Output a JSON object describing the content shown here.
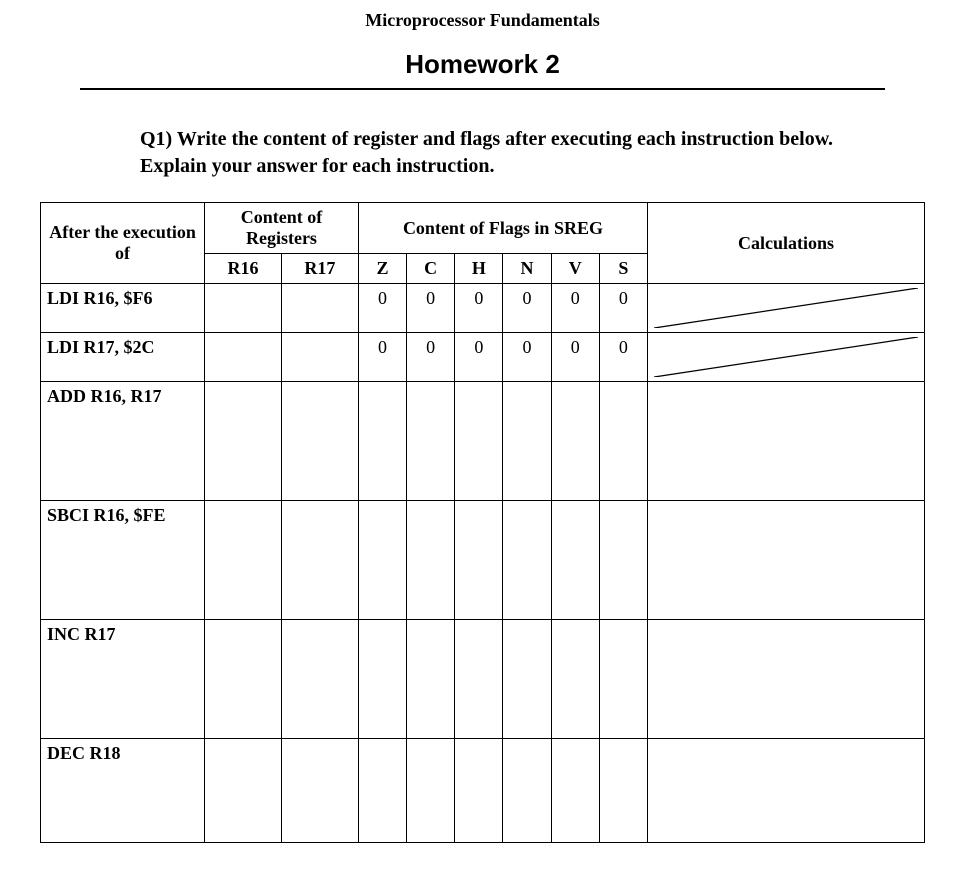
{
  "header": {
    "course": "Microprocessor Fundamentals",
    "title": "Homework 2"
  },
  "question": "Q1) Write the content of register and flags after executing each instruction below. Explain your answer for each instruction.",
  "table": {
    "headers": {
      "exec": "After the execution of",
      "regs": "Content of Registers",
      "flags": "Content of Flags in SREG",
      "calc": "Calculations",
      "r16": "R16",
      "r17": "R17",
      "z": "Z",
      "c": "C",
      "h": "H",
      "n": "N",
      "v": "V",
      "s": "S"
    },
    "rows": [
      {
        "instr": "LDI R16, $F6",
        "r16": "",
        "r17": "",
        "z": "0",
        "c": "0",
        "h": "0",
        "n": "0",
        "v": "0",
        "s": "0",
        "calc": "slash"
      },
      {
        "instr": "LDI R17, $2C",
        "r16": "",
        "r17": "",
        "z": "0",
        "c": "0",
        "h": "0",
        "n": "0",
        "v": "0",
        "s": "0",
        "calc": "slash"
      },
      {
        "instr": "ADD R16, R17",
        "r16": "",
        "r17": "",
        "z": "",
        "c": "",
        "h": "",
        "n": "",
        "v": "",
        "s": "",
        "calc": ""
      },
      {
        "instr": "SBCI  R16, $FE",
        "r16": "",
        "r17": "",
        "z": "",
        "c": "",
        "h": "",
        "n": "",
        "v": "",
        "s": "",
        "calc": ""
      },
      {
        "instr": "INC   R17",
        "r16": "",
        "r17": "",
        "z": "",
        "c": "",
        "h": "",
        "n": "",
        "v": "",
        "s": "",
        "calc": ""
      },
      {
        "instr": "DEC  R18",
        "r16": "",
        "r17": "",
        "z": "",
        "c": "",
        "h": "",
        "n": "",
        "v": "",
        "s": "",
        "calc": ""
      }
    ]
  }
}
